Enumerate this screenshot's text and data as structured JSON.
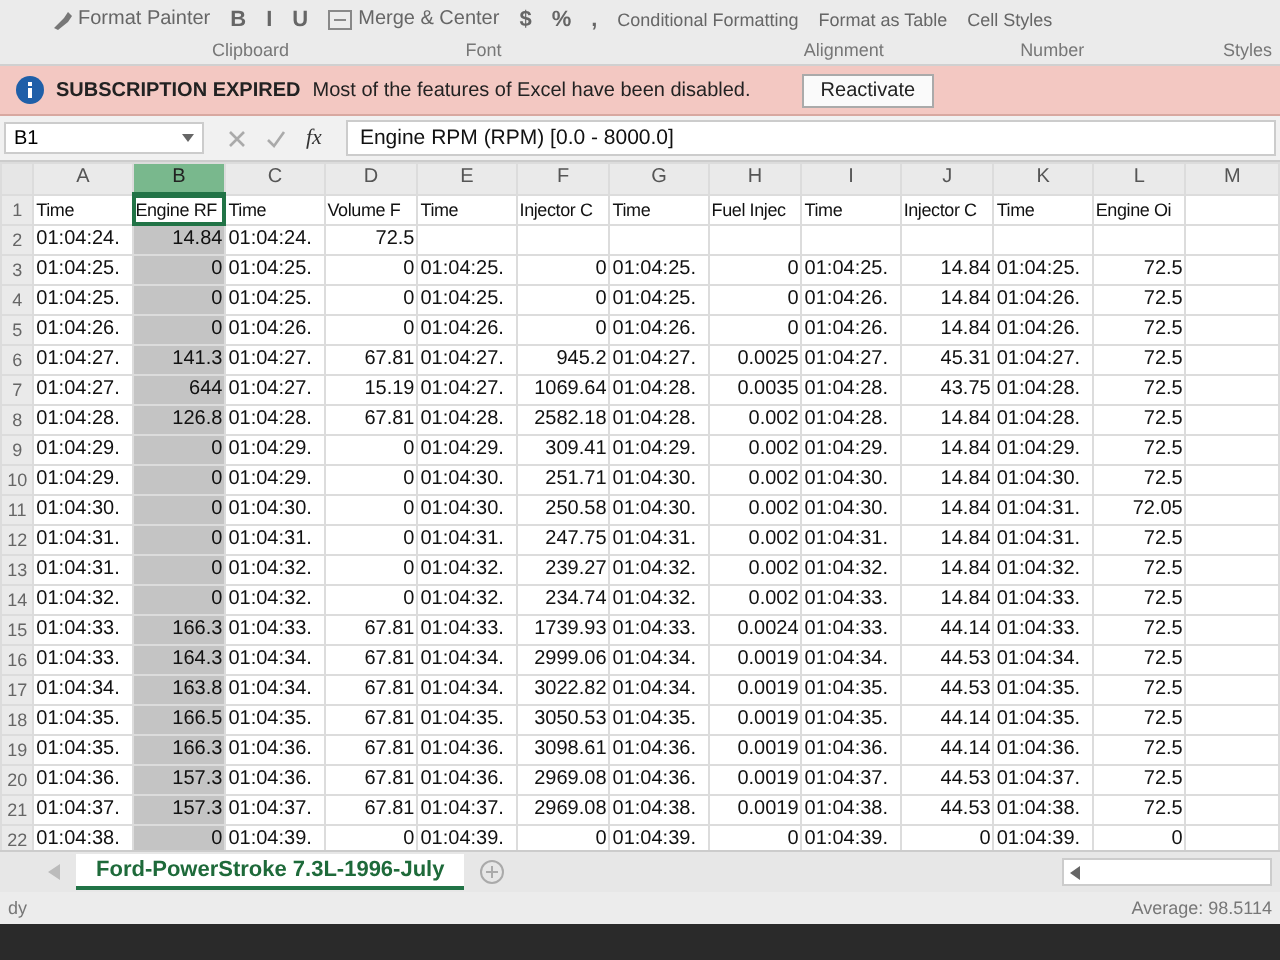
{
  "ribbon": {
    "top_items": [
      {
        "kind": "painter",
        "label": "Format Painter"
      },
      {
        "kind": "font",
        "label": "B"
      },
      {
        "kind": "font",
        "label": "I"
      },
      {
        "kind": "font",
        "label": "U"
      },
      {
        "kind": "align",
        "label": "Merge & Center"
      },
      {
        "kind": "font",
        "label": "$"
      },
      {
        "kind": "font",
        "label": "%"
      },
      {
        "kind": "font",
        "label": ","
      },
      {
        "kind": "style",
        "label": "Conditional Formatting"
      },
      {
        "kind": "style",
        "label": "Format as Table"
      },
      {
        "kind": "style",
        "label": "Cell Styles"
      }
    ],
    "groups": [
      "Clipboard",
      "Font",
      "Alignment",
      "Number",
      "Styles"
    ]
  },
  "banner": {
    "title": "SUBSCRIPTION EXPIRED",
    "message": "Most of the features of Excel have been disabled.",
    "button": "Reactivate"
  },
  "formula_bar": {
    "name_box": "B1",
    "fx": "fx",
    "formula": "Engine RPM (RPM) [0.0 - 8000.0]"
  },
  "columns": [
    {
      "letter": "A",
      "kind": "time",
      "selected": false
    },
    {
      "letter": "B",
      "kind": "number",
      "selected": true
    },
    {
      "letter": "C",
      "kind": "time",
      "selected": false
    },
    {
      "letter": "D",
      "kind": "number",
      "selected": false
    },
    {
      "letter": "E",
      "kind": "time",
      "selected": false
    },
    {
      "letter": "F",
      "kind": "number",
      "selected": false
    },
    {
      "letter": "G",
      "kind": "time",
      "selected": false
    },
    {
      "letter": "H",
      "kind": "number",
      "selected": false
    },
    {
      "letter": "I",
      "kind": "time",
      "selected": false
    },
    {
      "letter": "J",
      "kind": "number",
      "selected": false
    },
    {
      "letter": "K",
      "kind": "time",
      "selected": false
    },
    {
      "letter": "L",
      "kind": "number",
      "selected": false
    },
    {
      "letter": "M",
      "kind": "number",
      "selected": false
    }
  ],
  "rows": [
    {
      "number": "1",
      "kind": "header",
      "cells": [
        "Time",
        "Engine RF",
        "Time",
        "Volume F",
        "Time",
        "Injector C",
        "Time",
        "Fuel Injec",
        "Time",
        "Injector C",
        "Time",
        "Engine Oi",
        null
      ]
    },
    {
      "number": "2",
      "kind": "data",
      "cells": [
        "01:04:24.",
        "14.84",
        "01:04:24.",
        "72.5",
        null,
        null,
        null,
        null,
        null,
        null,
        null,
        null,
        null
      ]
    },
    {
      "number": "3",
      "kind": "data",
      "cells": [
        "01:04:25.",
        "0",
        "01:04:25.",
        "0",
        "01:04:25.",
        "0",
        "01:04:25.",
        "0",
        "01:04:25.",
        "14.84",
        "01:04:25.",
        "72.5",
        null
      ]
    },
    {
      "number": "4",
      "kind": "data",
      "cells": [
        "01:04:25.",
        "0",
        "01:04:25.",
        "0",
        "01:04:25.",
        "0",
        "01:04:25.",
        "0",
        "01:04:26.",
        "14.84",
        "01:04:26.",
        "72.5",
        null
      ]
    },
    {
      "number": "5",
      "kind": "data",
      "cells": [
        "01:04:26.",
        "0",
        "01:04:26.",
        "0",
        "01:04:26.",
        "0",
        "01:04:26.",
        "0",
        "01:04:26.",
        "14.84",
        "01:04:26.",
        "72.5",
        null
      ]
    },
    {
      "number": "6",
      "kind": "data",
      "cells": [
        "01:04:27.",
        "141.3",
        "01:04:27.",
        "67.81",
        "01:04:27.",
        "945.2",
        "01:04:27.",
        "0.0025",
        "01:04:27.",
        "45.31",
        "01:04:27.",
        "72.5",
        null
      ]
    },
    {
      "number": "7",
      "kind": "data",
      "cells": [
        "01:04:27.",
        "644",
        "01:04:27.",
        "15.19",
        "01:04:27.",
        "1069.64",
        "01:04:28.",
        "0.0035",
        "01:04:28.",
        "43.75",
        "01:04:28.",
        "72.5",
        null
      ]
    },
    {
      "number": "8",
      "kind": "data",
      "cells": [
        "01:04:28.",
        "126.8",
        "01:04:28.",
        "67.81",
        "01:04:28.",
        "2582.18",
        "01:04:28.",
        "0.002",
        "01:04:28.",
        "14.84",
        "01:04:28.",
        "72.5",
        null
      ]
    },
    {
      "number": "9",
      "kind": "data",
      "cells": [
        "01:04:29.",
        "0",
        "01:04:29.",
        "0",
        "01:04:29.",
        "309.41",
        "01:04:29.",
        "0.002",
        "01:04:29.",
        "14.84",
        "01:04:29.",
        "72.5",
        null
      ]
    },
    {
      "number": "10",
      "kind": "data",
      "cells": [
        "01:04:29.",
        "0",
        "01:04:29.",
        "0",
        "01:04:30.",
        "251.71",
        "01:04:30.",
        "0.002",
        "01:04:30.",
        "14.84",
        "01:04:30.",
        "72.5",
        null
      ]
    },
    {
      "number": "11",
      "kind": "data",
      "cells": [
        "01:04:30.",
        "0",
        "01:04:30.",
        "0",
        "01:04:30.",
        "250.58",
        "01:04:30.",
        "0.002",
        "01:04:30.",
        "14.84",
        "01:04:31.",
        "72.05",
        null
      ]
    },
    {
      "number": "12",
      "kind": "data",
      "cells": [
        "01:04:31.",
        "0",
        "01:04:31.",
        "0",
        "01:04:31.",
        "247.75",
        "01:04:31.",
        "0.002",
        "01:04:31.",
        "14.84",
        "01:04:31.",
        "72.5",
        null
      ]
    },
    {
      "number": "13",
      "kind": "data",
      "cells": [
        "01:04:31.",
        "0",
        "01:04:32.",
        "0",
        "01:04:32.",
        "239.27",
        "01:04:32.",
        "0.002",
        "01:04:32.",
        "14.84",
        "01:04:32.",
        "72.5",
        null
      ]
    },
    {
      "number": "14",
      "kind": "data",
      "cells": [
        "01:04:32.",
        "0",
        "01:04:32.",
        "0",
        "01:04:32.",
        "234.74",
        "01:04:32.",
        "0.002",
        "01:04:33.",
        "14.84",
        "01:04:33.",
        "72.5",
        null
      ]
    },
    {
      "number": "15",
      "kind": "data",
      "cells": [
        "01:04:33.",
        "166.3",
        "01:04:33.",
        "67.81",
        "01:04:33.",
        "1739.93",
        "01:04:33.",
        "0.0024",
        "01:04:33.",
        "44.14",
        "01:04:33.",
        "72.5",
        null
      ]
    },
    {
      "number": "16",
      "kind": "data",
      "cells": [
        "01:04:33.",
        "164.3",
        "01:04:34.",
        "67.81",
        "01:04:34.",
        "2999.06",
        "01:04:34.",
        "0.0019",
        "01:04:34.",
        "44.53",
        "01:04:34.",
        "72.5",
        null
      ]
    },
    {
      "number": "17",
      "kind": "data",
      "cells": [
        "01:04:34.",
        "163.8",
        "01:04:34.",
        "67.81",
        "01:04:34.",
        "3022.82",
        "01:04:34.",
        "0.0019",
        "01:04:35.",
        "44.53",
        "01:04:35.",
        "72.5",
        null
      ]
    },
    {
      "number": "18",
      "kind": "data",
      "cells": [
        "01:04:35.",
        "166.5",
        "01:04:35.",
        "67.81",
        "01:04:35.",
        "3050.53",
        "01:04:35.",
        "0.0019",
        "01:04:35.",
        "44.14",
        "01:04:35.",
        "72.5",
        null
      ]
    },
    {
      "number": "19",
      "kind": "data",
      "cells": [
        "01:04:35.",
        "166.3",
        "01:04:36.",
        "67.81",
        "01:04:36.",
        "3098.61",
        "01:04:36.",
        "0.0019",
        "01:04:36.",
        "44.14",
        "01:04:36.",
        "72.5",
        null
      ]
    },
    {
      "number": "20",
      "kind": "data",
      "cells": [
        "01:04:36.",
        "157.3",
        "01:04:36.",
        "67.81",
        "01:04:36.",
        "2969.08",
        "01:04:36.",
        "0.0019",
        "01:04:37.",
        "44.53",
        "01:04:37.",
        "72.5",
        null
      ]
    },
    {
      "number": "21",
      "kind": "data",
      "cells": [
        "01:04:37.",
        "157.3",
        "01:04:37.",
        "67.81",
        "01:04:37.",
        "2969.08",
        "01:04:38.",
        "0.0019",
        "01:04:38.",
        "44.53",
        "01:04:38.",
        "72.5",
        null
      ]
    },
    {
      "number": "22",
      "kind": "data",
      "cells": [
        "01:04:38.",
        "0",
        "01:04:39.",
        "0",
        "01:04:39.",
        "0",
        "01:04:39.",
        "0",
        "01:04:39.",
        "0",
        "01:04:39.",
        "0",
        null
      ]
    }
  ],
  "sheet_tabs": [
    {
      "label": "Ford-PowerStroke 7.3L-1996-July",
      "selected": true
    }
  ],
  "status_bar": {
    "left": "dy",
    "right": "Average: 98.5114"
  }
}
